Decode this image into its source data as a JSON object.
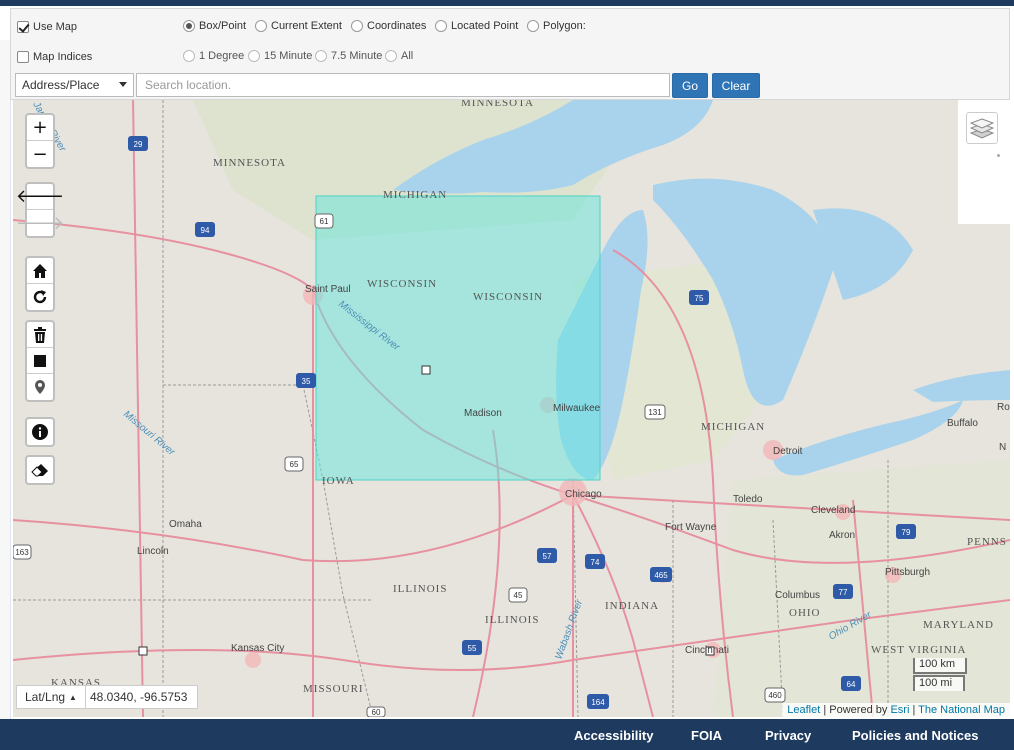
{
  "options": {
    "use_map": {
      "label": "Use Map",
      "checked": true
    },
    "map_indices": {
      "label": "Map Indices",
      "checked": false
    },
    "selection_modes": [
      {
        "label": "Box/Point",
        "selected": true
      },
      {
        "label": "Current Extent",
        "selected": false
      },
      {
        "label": "Coordinates",
        "selected": false
      },
      {
        "label": "Located Point",
        "selected": false
      },
      {
        "label": "Polygon:",
        "selected": false
      }
    ],
    "index_modes": [
      {
        "label": "1 Degree"
      },
      {
        "label": "15 Minute"
      },
      {
        "label": "7.5 Minute"
      },
      {
        "label": "All"
      }
    ]
  },
  "search": {
    "type_selected": "Address/Place",
    "placeholder": "Search location.",
    "value": "",
    "go_label": "Go",
    "clear_label": "Clear"
  },
  "map": {
    "state_labels": [
      "MINNESOTA",
      "MINNESOTA",
      "MICHIGAN",
      "WISCONSIN",
      "WISCONSIN",
      "IOWA",
      "MICHIGAN",
      "ILLINOIS",
      "ILLINOIS",
      "INDIANA",
      "OHIO",
      "WEST VIRGINIA",
      "MARYLAND",
      "MISSOURI",
      "KANSAS",
      "PENNS"
    ],
    "city_labels": [
      "Saint Paul",
      "Madison",
      "Milwaukee",
      "Chicago",
      "Toledo",
      "Detroit",
      "Cleveland",
      "Akron",
      "Fort Wayne",
      "Columbus",
      "Pittsburgh",
      "Cincinnati",
      "Buffalo",
      "Omaha",
      "Lincoln",
      "Kansas City",
      "Ro",
      "N"
    ],
    "river_labels": [
      "Mississippi River",
      "Missouri River",
      "Wabash River",
      "Ohio River",
      "James River"
    ],
    "highway_shields": [
      "29",
      "94",
      "61",
      "35",
      "65",
      "75",
      "131",
      "57",
      "74",
      "465",
      "45",
      "55",
      "164",
      "64",
      "77",
      "79",
      "460",
      "60",
      "163"
    ],
    "selection_box_color": "#63e6dd",
    "selection_box_opacity": 0.5
  },
  "controls": {
    "zoom_in": "+",
    "zoom_out": "−"
  },
  "coords": {
    "format": "Lat/Lng",
    "value": "48.0340, -96.5753"
  },
  "scale": {
    "metric": "100 km",
    "imperial": "100 mi"
  },
  "attribution": {
    "leaflet": "Leaflet",
    "powered_by": "| Powered by",
    "esri": "Esri",
    "separator": "|",
    "tnm": "The National Map"
  },
  "footer": {
    "links": [
      "Accessibility",
      "FOIA",
      "Privacy",
      "Policies and Notices"
    ]
  },
  "colors": {
    "accent": "#2f74b5",
    "footer_bg": "#1e3a5f",
    "water": "#a9d3ec",
    "land": "#e6e4dc",
    "highway": "#e8889a"
  }
}
